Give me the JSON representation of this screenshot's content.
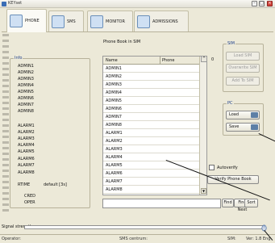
{
  "window": {
    "title": "KEYset"
  },
  "tabs": [
    {
      "label": "PHONE"
    },
    {
      "label": "SMS"
    },
    {
      "label": "MONITOR"
    },
    {
      "label": "ADMISSIONS"
    }
  ],
  "info": {
    "legend": "Info",
    "admins": [
      "ADMIN1",
      "ADMIN2",
      "ADMIN3",
      "ADMIN4",
      "ADMIN5",
      "ADMIN6",
      "ADMIN7",
      "ADMIN8"
    ],
    "alarms": [
      "ALARM1",
      "ALARM2",
      "ALARM3",
      "ALARM4",
      "ALARM5",
      "ALARM6",
      "ALARM7",
      "ALARM8"
    ],
    "rtime_label": "RTIME",
    "rtime_value": "default [3s]",
    "cred_label": "CRED",
    "oper_label": "OPER"
  },
  "phonebook": {
    "title": "Phone Book in SIM",
    "columns": [
      "Name",
      "Phone"
    ],
    "rows": [
      "ADMIN1",
      "ADMIN2",
      "ADMIN3",
      "ADMIN4",
      "ADMIN5",
      "ADMIN6",
      "ADMIN7",
      "ADMIN8",
      "ALARM1",
      "ALARM2",
      "ALARM3",
      "ALARM4",
      "ALARM5",
      "ALARM6",
      "ALARM7",
      "ALARM8"
    ],
    "count": "0",
    "find_value": "",
    "find_label": "Find",
    "find_next_label": "Find Next",
    "sort_label": "Sort"
  },
  "sim": {
    "legend": "SIM",
    "load_label": "Load SIM",
    "overwrite_label": "Overwrite SIM",
    "add_label": "Add To SIM"
  },
  "pc": {
    "legend": "PC",
    "load_label": "Load",
    "save_label": "Save"
  },
  "autoverify_label": "Autoverify",
  "verify_label": "Verify Phone Book",
  "signal": {
    "label": "Signal strength",
    "level": 0
  },
  "status": {
    "operator": "Operator:",
    "sms_centrum": "SMS centrum:",
    "sim": "SIM:",
    "version": "Ver: 1.8 Eng"
  }
}
